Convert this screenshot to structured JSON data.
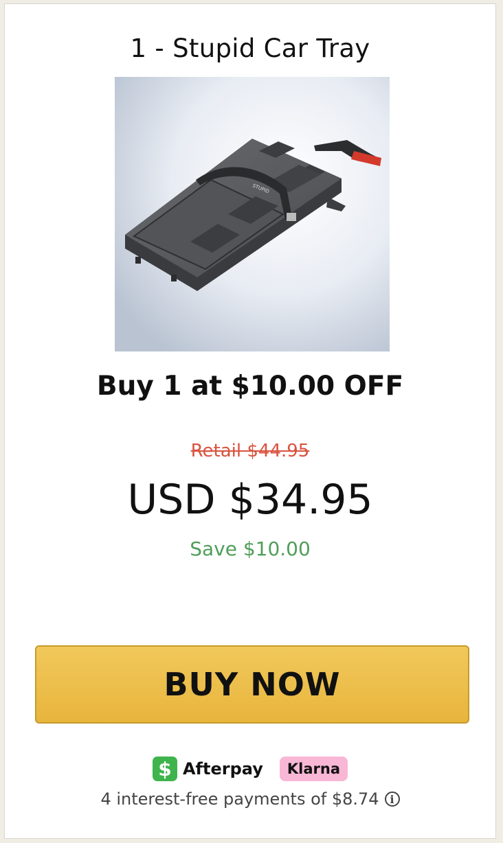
{
  "product": {
    "title": "1 - Stupid Car Tray",
    "image_alt": "Stupid Car Tray product photo",
    "logo_text": "STUPID"
  },
  "offer": {
    "headline": "Buy 1 at $10.00 OFF",
    "retail": "Retail $44.95",
    "price": "USD $34.95",
    "save": "Save $10.00"
  },
  "cta": {
    "buy_label": "BUY NOW"
  },
  "payments": {
    "cash_icon": "$",
    "afterpay": "Afterpay",
    "klarna": "Klarna",
    "installments": "4 interest-free payments of $8.74",
    "info_icon": "i"
  },
  "colors": {
    "retail": "#d9533f",
    "save": "#4f9e59",
    "button": "#edbd4a",
    "klarna": "#f9b7d6",
    "cash": "#3fb44d"
  }
}
